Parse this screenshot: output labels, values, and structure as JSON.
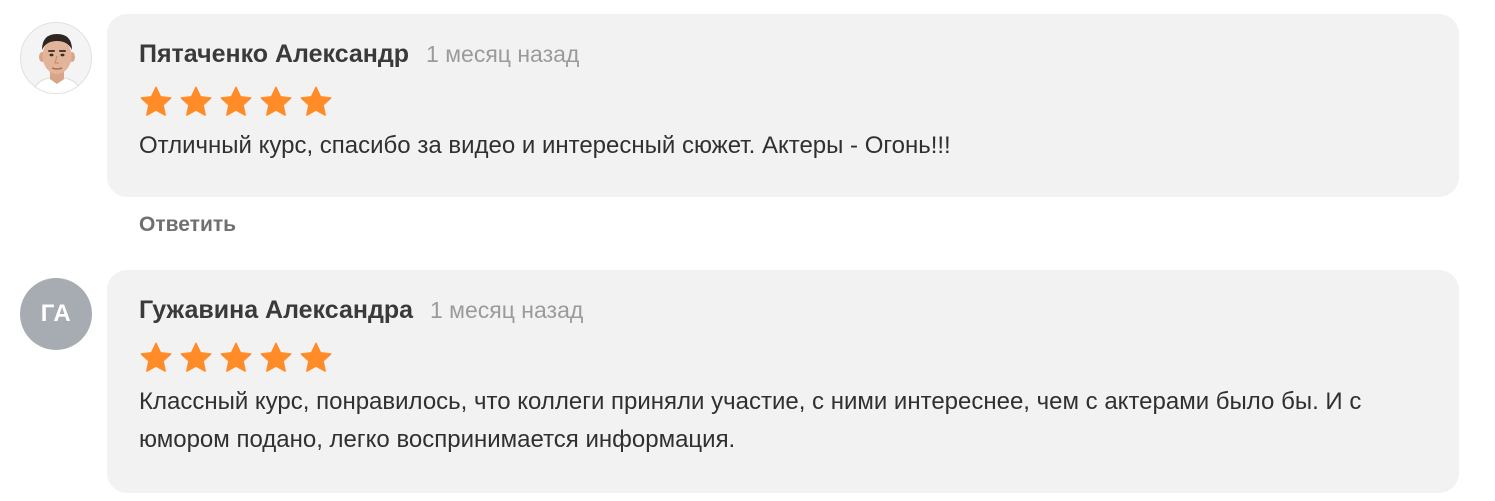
{
  "reviews": [
    {
      "author": "Пятаченко Александр",
      "time": "1 месяц назад",
      "rating": 5,
      "rating_max": 5,
      "text": "Отличный курс, спасибо за видео и интересный сюжет. Актеры - Огонь!!!",
      "reply_label": "Ответить",
      "avatar_type": "photo"
    },
    {
      "author": "Гужавина Александра",
      "time": "1 месяц назад",
      "rating": 5,
      "rating_max": 5,
      "text": "Классный курс, понравилось, что коллеги приняли участие, с ними интереснее, чем с актерами было бы. И с юмором подано, легко воспринимается информация.",
      "avatar_initials": "ГА",
      "avatar_type": "initials"
    }
  ],
  "colors": {
    "star": "#ff8c26",
    "bubble_bg": "#f2f2f2",
    "initials_avatar_bg": "#a7abb2"
  },
  "icons": {
    "star": "star-icon"
  }
}
